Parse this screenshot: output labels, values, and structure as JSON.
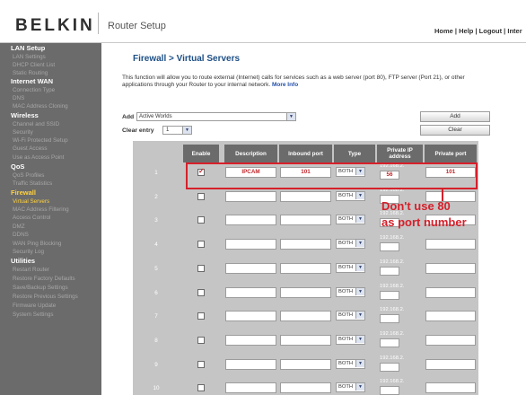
{
  "header": {
    "logo": "BELKIN",
    "app_title": "Router Setup",
    "links": [
      "Home",
      "Help",
      "Logout",
      "Inter"
    ],
    "separator": " | "
  },
  "sidebar": {
    "categories": {
      "lan": "LAN Setup",
      "internet_wan": "Internet WAN",
      "wireless": "Wireless",
      "qos": "QoS",
      "firewall": "Firewall",
      "utilities": "Utilities"
    },
    "items": {
      "lan_settings": "LAN Settings",
      "dhcp_client_list": "DHCP Client List",
      "static_routing": "Static Routing",
      "connection_type": "Connection Type",
      "dns": "DNS",
      "mac_address_cloning": "MAC Address Cloning",
      "channel_ssid": "Channel and SSID",
      "security": "Security",
      "wps": "Wi-Fi Protected Setup",
      "guest_access": "Guest Access",
      "use_as_ap": "Use as Access Point",
      "qos_profiles": "QoS Profiles",
      "traffic_statistics": "Traffic Statistics",
      "virtual_servers": "Virtual Servers",
      "mac_filtering": "MAC Address Filtering",
      "access_control": "Access Control",
      "dmz": "DMZ",
      "ddns": "DDNS",
      "wan_ping_blocking": "WAN Ping Blocking",
      "security_log": "Security Log",
      "restart_router": "Restart Router",
      "restore_factory": "Restore Factory Defaults",
      "save_backup": "Save/Backup Settings",
      "restore_previous": "Restore Previous Settings",
      "firmware_update": "Firmware Update",
      "system_settings": "System Settings"
    }
  },
  "main": {
    "title": "Firewall > Virtual Servers",
    "intro": "This function will allow you to route external (Internet) calls for services such as a web server (port 80), FTP server (Port 21), or other applications through your Router to your internal network.",
    "more_info": "More Info",
    "add_label": "Add",
    "add_select_value": "Active Worlds",
    "clear_label": "Clear entry",
    "clear_select_value": "1",
    "add_button": "Add",
    "clear_button": "Clear"
  },
  "table": {
    "headers": {
      "enable": "Enable",
      "description": "Description",
      "inbound_port": "Inbound port",
      "type": "Type",
      "private_ip": "Private IP address",
      "private_port": "Private port"
    },
    "ip_prefix": "192.168.2.",
    "type_value": "BOTH",
    "rows": [
      {
        "index": "1",
        "enabled": true,
        "description": "IPCAM",
        "inbound_port": "101",
        "ip_last": "56",
        "private_port": "101"
      },
      {
        "index": "2",
        "enabled": false,
        "description": "",
        "inbound_port": "",
        "ip_last": "",
        "private_port": ""
      },
      {
        "index": "3",
        "enabled": false,
        "description": "",
        "inbound_port": "",
        "ip_last": "",
        "private_port": ""
      },
      {
        "index": "4",
        "enabled": false,
        "description": "",
        "inbound_port": "",
        "ip_last": "",
        "private_port": ""
      },
      {
        "index": "5",
        "enabled": false,
        "description": "",
        "inbound_port": "",
        "ip_last": "",
        "private_port": ""
      },
      {
        "index": "6",
        "enabled": false,
        "description": "",
        "inbound_port": "",
        "ip_last": "",
        "private_port": ""
      },
      {
        "index": "7",
        "enabled": false,
        "description": "",
        "inbound_port": "",
        "ip_last": "",
        "private_port": ""
      },
      {
        "index": "8",
        "enabled": false,
        "description": "",
        "inbound_port": "",
        "ip_last": "",
        "private_port": ""
      },
      {
        "index": "9",
        "enabled": false,
        "description": "",
        "inbound_port": "",
        "ip_last": "",
        "private_port": ""
      },
      {
        "index": "10",
        "enabled": false,
        "description": "",
        "inbound_port": "",
        "ip_last": "",
        "private_port": ""
      }
    ]
  },
  "annotation": {
    "line1": "Don't use 80",
    "line2": "as port number"
  },
  "colors": {
    "annotation_red": "#d6202b",
    "sidebar_bg": "#6b6b6b",
    "title_blue": "#1d4f86",
    "active_menu": "#ffd23f"
  }
}
